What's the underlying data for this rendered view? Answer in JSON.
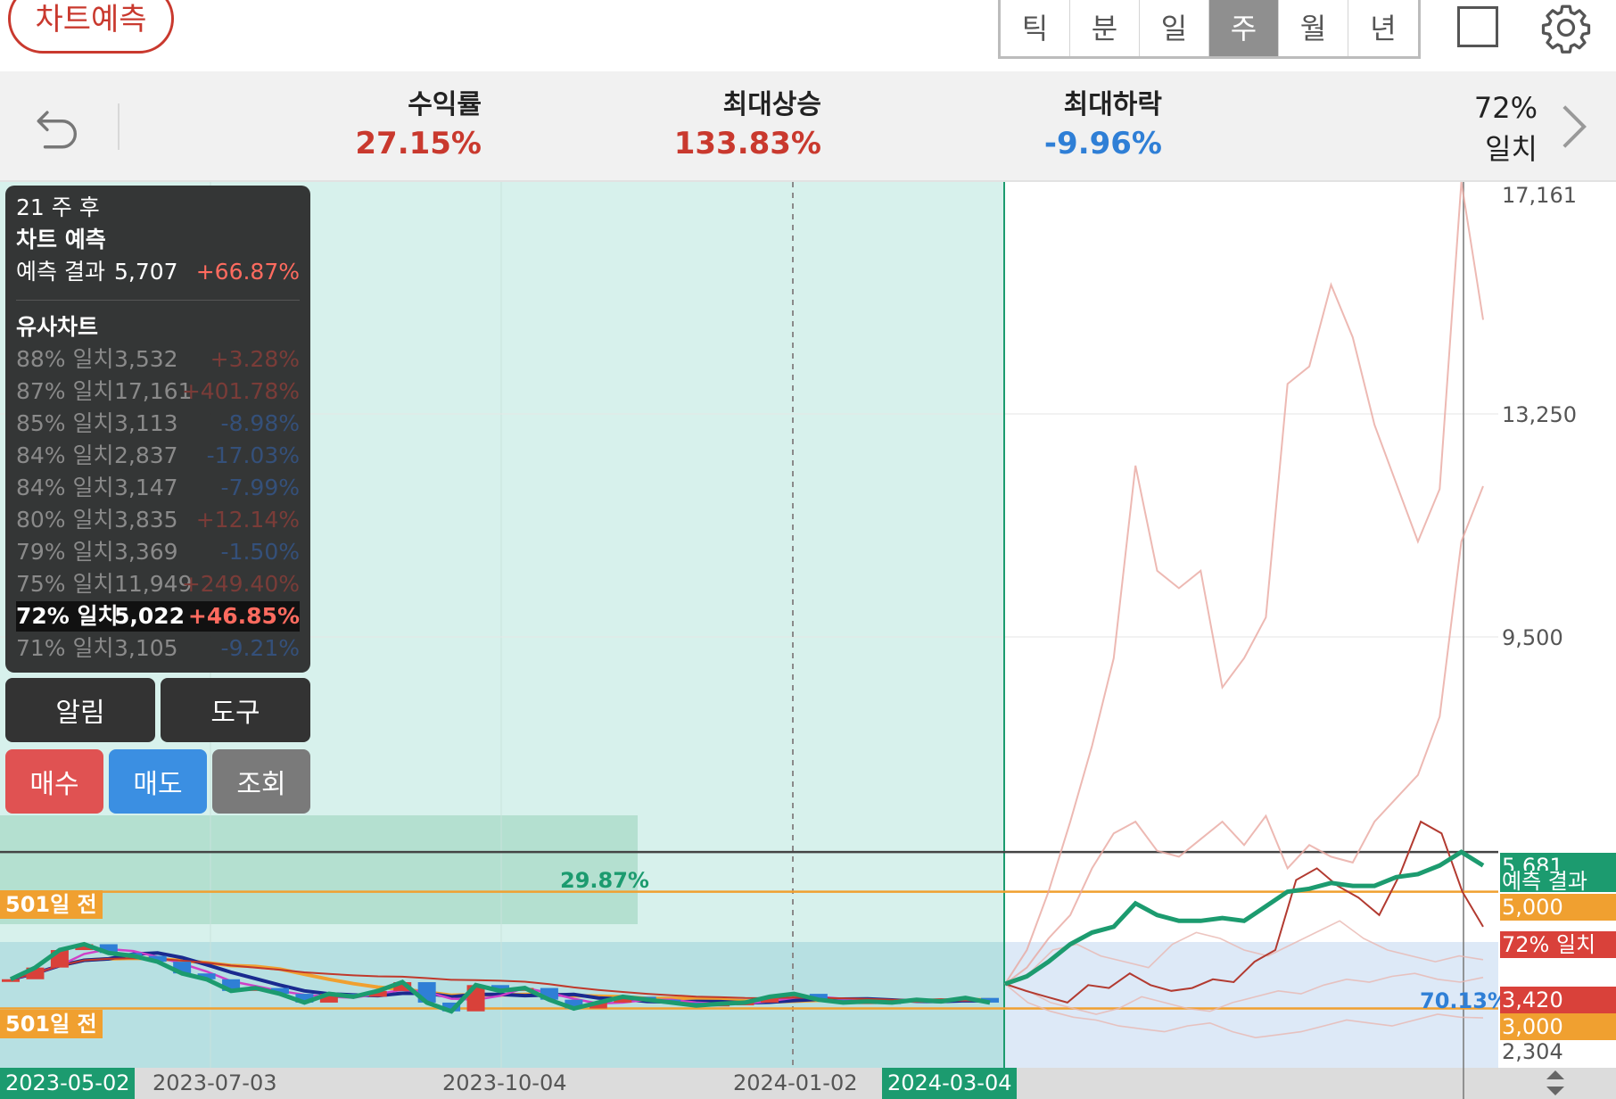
{
  "header": {
    "predict_button": "차트예측",
    "period_tabs": [
      {
        "label": "틱",
        "active": false
      },
      {
        "label": "분",
        "active": false
      },
      {
        "label": "일",
        "active": false
      },
      {
        "label": "주",
        "active": true
      },
      {
        "label": "월",
        "active": false
      },
      {
        "label": "년",
        "active": false
      }
    ],
    "icons": [
      "square-icon",
      "gear-icon"
    ]
  },
  "stats": {
    "return_label": "수익률",
    "return_value": "27.15%",
    "max_rise_label": "최대상승",
    "max_rise_value": "133.83%",
    "max_fall_label": "최대하락",
    "max_fall_value": "-9.96%",
    "match_percent": "72%",
    "match_label": "일치",
    "colors": {
      "up": "#c9392e",
      "down": "#2f7fd6"
    }
  },
  "info_panel": {
    "weeks_after": "21 주 후",
    "prediction_title": "차트 예측",
    "prediction_result_label": "예측 결과",
    "prediction_result_value": "5,707",
    "prediction_result_change": "+66.87%",
    "similar_title": "유사차트",
    "similar": [
      {
        "match": "88% 일치",
        "price": "3,532",
        "change": "+3.28%"
      },
      {
        "match": "87% 일치",
        "price": "17,161",
        "change": "+401.78%"
      },
      {
        "match": "85% 일치",
        "price": "3,113",
        "change": "-8.98%"
      },
      {
        "match": "84% 일치",
        "price": "2,837",
        "change": "-17.03%"
      },
      {
        "match": "84% 일치",
        "price": "3,147",
        "change": "-7.99%"
      },
      {
        "match": "80% 일치",
        "price": "3,835",
        "change": "+12.14%"
      },
      {
        "match": "79% 일치",
        "price": "3,369",
        "change": "-1.50%"
      },
      {
        "match": "75% 일치",
        "price": "11,949",
        "change": "+249.40%"
      },
      {
        "match": "72% 일치",
        "price": "5,022",
        "change": "+46.85%",
        "selected": true
      },
      {
        "match": "71% 일치",
        "price": "3,105",
        "change": "-9.21%"
      }
    ]
  },
  "buttons": {
    "alert": "알림",
    "tools": "도구",
    "buy": "매수",
    "sell": "매도",
    "inquiry": "조회"
  },
  "chart_data": {
    "type": "line",
    "x_ticks": [
      "2023-05-02",
      "2023-07-03",
      "2023-10-04",
      "2024-01-02",
      "2024-03-04"
    ],
    "y_ticks": [
      "17,161",
      "13,250",
      "9,500",
      "2,304"
    ],
    "annotations": {
      "box_percent": "29.87%",
      "line_501_upper": "501일 전",
      "line_501_lower": "501일 전",
      "match_percent": "70.13%"
    },
    "price_boxes": [
      {
        "label": "5,681",
        "color": "#1c9b6f"
      },
      {
        "label": "예측 결과",
        "color": "#1c9b6f"
      },
      {
        "label": "5,000",
        "color": "#f0a030"
      },
      {
        "label": "72% 일치",
        "color": "#d9413a"
      },
      {
        "label": "3,420",
        "color": "#d9413a"
      },
      {
        "label": "3,000",
        "color": "#f0a030"
      }
    ],
    "y_scale": [
      2304,
      17161
    ],
    "horizontal_lines": [
      5000,
      3000,
      5681
    ],
    "history_close": [
      3500,
      3700,
      4000,
      4100,
      3950,
      3900,
      3800,
      3600,
      3500,
      3300,
      3350,
      3250,
      3100,
      3250,
      3200,
      3300,
      3450,
      3100,
      2950,
      3400,
      3300,
      3350,
      3150,
      3000,
      3100,
      3200,
      3150,
      3100,
      3050,
      3080,
      3100,
      3200,
      3250,
      3150,
      3100,
      3120,
      3100,
      3150,
      3120,
      3180,
      3100
    ],
    "prediction": [
      3420,
      3550,
      3800,
      4100,
      4300,
      4400,
      4800,
      4600,
      4500,
      4500,
      4550,
      4500,
      4750,
      5000,
      5050,
      5150,
      5100,
      5100,
      5250,
      5300,
      5450,
      5681,
      5450
    ],
    "similar_72": [
      3420,
      3300,
      3200,
      3100,
      3400,
      3350,
      3600,
      3400,
      3300,
      3350,
      3500,
      3450,
      3800,
      4000,
      5200,
      5400,
      5100,
      4900,
      4600,
      5300,
      6200,
      6000,
      5000,
      4400
    ],
    "similar_87": [
      3420,
      4000,
      5000,
      6200,
      7500,
      9000,
      12300,
      10500,
      10200,
      10500,
      8500,
      9000,
      9700,
      13700,
      14000,
      15400,
      14500,
      13000,
      12000,
      11000,
      11900,
      17161,
      14800
    ],
    "similar_75": [
      3420,
      3700,
      4200,
      4600,
      5400,
      6000,
      6200,
      5700,
      5600,
      5900,
      6200,
      5800,
      6300,
      5400,
      5800,
      5600,
      5500,
      6200,
      6600,
      7000,
      8000,
      11000,
      11949
    ],
    "similar_other": [
      [
        3420,
        3300,
        3100,
        3000,
        2900,
        3000,
        3200,
        3100,
        3000,
        2950,
        3100,
        3200,
        3300,
        3250,
        3400,
        3500,
        3450,
        3550,
        3600,
        3500,
        3450,
        3532
      ],
      [
        3420,
        3100,
        2950,
        2850,
        2800,
        2700,
        2650,
        2600,
        2700,
        2750,
        2600,
        2500,
        2550,
        2600,
        2700,
        2800,
        2750,
        2700,
        2800,
        2900,
        2850,
        2837
      ],
      [
        3420,
        3600,
        4000,
        4100,
        3900,
        3800,
        3700,
        4100,
        4300,
        4200,
        4000,
        3900,
        4100,
        4300,
        4500,
        4200,
        4000,
        3900,
        3800,
        3900,
        3835
      ]
    ]
  }
}
